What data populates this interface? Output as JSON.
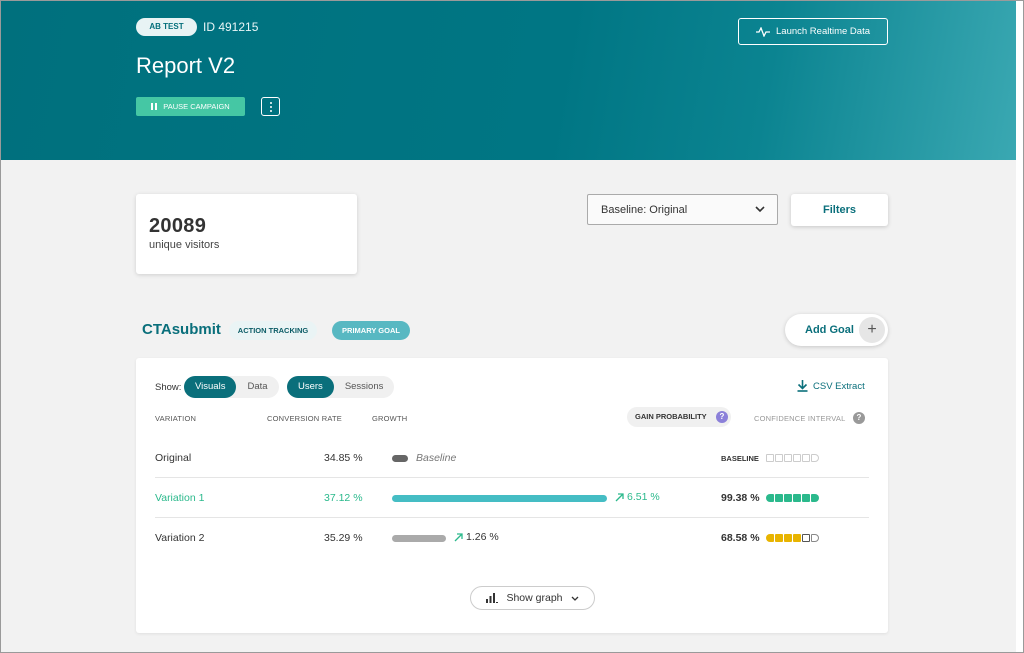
{
  "header": {
    "chip": "AB TEST",
    "id_text": "ID 491215",
    "title": "Report V2",
    "pause_label": "PAUSE CAMPAIGN",
    "launch_label": "Launch Realtime Data"
  },
  "summary": {
    "visitors_count": "20089",
    "visitors_label": "unique visitors",
    "baseline_select": "Baseline: Original",
    "filters_label": "Filters"
  },
  "goal": {
    "name": "CTAsubmit",
    "tracking_chip": "ACTION TRACKING",
    "primary_chip": "PRIMARY GOAL",
    "add_goal_label": "Add Goal",
    "add_icon": "+"
  },
  "controls": {
    "show_label": "Show:",
    "view_options": [
      "Visuals",
      "Data"
    ],
    "view_selected": "Visuals",
    "metric_options": [
      "Users",
      "Sessions"
    ],
    "metric_selected": "Users",
    "csv_label": "CSV Extract"
  },
  "table": {
    "headers": {
      "variation": "VARIATION",
      "conversion": "CONVERSION RATE",
      "growth": "GROWTH",
      "gain": "GAIN PROBABILITY",
      "confidence": "CONFIDENCE INTERVAL",
      "help_icon": "?"
    },
    "rows": [
      {
        "name": "Original",
        "conversion": "34.85 %",
        "growth_label": "Baseline",
        "gain": "BASELINE",
        "bar_fraction": 0.0,
        "confidence_filled": 0,
        "confidence_partial": 0,
        "confidence_total": 6
      },
      {
        "name": "Variation 1",
        "conversion": "37.12 %",
        "growth": "6.51 %",
        "gain": "99.38 %",
        "bar_fraction": 1.0,
        "confidence_filled": 6,
        "confidence_partial": 0,
        "confidence_total": 6
      },
      {
        "name": "Variation 2",
        "conversion": "35.29 %",
        "growth": "1.26 %",
        "gain": "68.58 %",
        "bar_fraction": 0.25,
        "confidence_filled": 4,
        "confidence_partial": 1,
        "confidence_total": 6
      }
    ]
  },
  "footer": {
    "show_graph_label": "Show graph"
  },
  "colors": {
    "brand_teal": "#0a6f7b",
    "success_green": "#2bb98c",
    "warning_yellow": "#e8b400",
    "growth_bar": "#45bdc4",
    "neutral_bar": "#aaaaaa",
    "gain_help": "#8b80d9"
  }
}
